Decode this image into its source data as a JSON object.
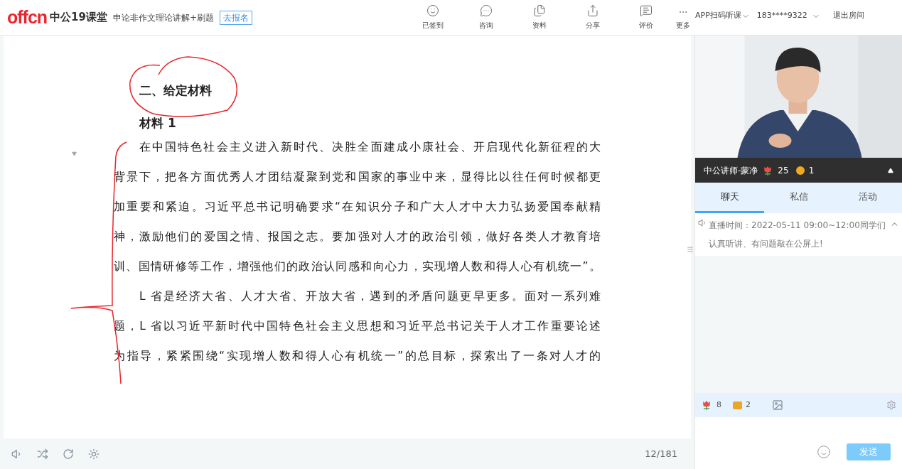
{
  "header": {
    "logo": "offcn",
    "brand": "中公19课堂",
    "course_title": "申论非作文理论讲解+刷题",
    "enroll_button": "去报名",
    "tools": [
      {
        "label": "已签到"
      },
      {
        "label": "咨询"
      },
      {
        "label": "资料"
      },
      {
        "label": "分享"
      },
      {
        "label": "评价"
      },
      {
        "label": "更多"
      }
    ],
    "app_menu": "APP扫码听课",
    "account": "183****9322",
    "exit": "退出房间"
  },
  "document": {
    "heading": "二、给定材料",
    "subheading": "材料 1",
    "paragraphs": [
      {
        "lines": [
          "在中国特色社会主义进入新时代、决胜全面建成小康社会、开启现代化新征程的大",
          "背景下，把各方面优秀人才团结凝聚到党和国家的事业中来，显得比以往任何时候都更",
          "加重要和紧迫。习近平总书记明确要求“在知识分子和广大人才中大力弘扬爱国奉献精",
          "神，激励他们的爱国之情、报国之志。要加强对人才的政治引领，做好各类人才教育培",
          "训、国情研修等工作，增强他们的政治认同感和向心力，实现增人数和得人心有机统一”。"
        ]
      },
      {
        "lines": [
          "L 省是经济大省、人才大省、开放大省，遇到的矛盾问题更早更多。面对一系列难",
          "题，L 省以习近平新时代中国特色社会主义思想和习近平总书记关于人才工作重要论述",
          "为指导，紧紧围绕“实现增人数和得人心有机统一”的总目标，探索出了一条对人才的"
        ]
      }
    ]
  },
  "player_bar": {
    "page": "12/181"
  },
  "live": {
    "teacher": "中公讲师-蒙净",
    "flowers": "25",
    "coins": "1",
    "tabs": [
      {
        "label": "聊天",
        "selected": true
      },
      {
        "label": "私信",
        "selected": false
      },
      {
        "label": "活动",
        "selected": false
      }
    ],
    "notice": "直播时间：2022-05-11 09:00~12:00同学们认真听讲、有问题敲在公屏上!",
    "gift_flowers": "8",
    "gift_coins": "2",
    "send_button": "发送"
  }
}
